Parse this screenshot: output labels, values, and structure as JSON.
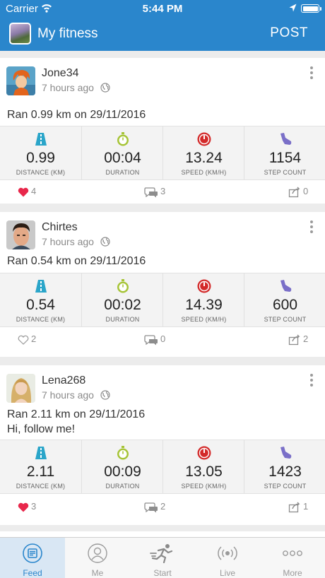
{
  "status_bar": {
    "carrier": "Carrier",
    "time": "5:44 PM"
  },
  "app_bar": {
    "title": "My fitness",
    "post_label": "POST"
  },
  "colors": {
    "primary": "#2a86cc",
    "distance": "#2aa5c9",
    "duration": "#a6c437",
    "speed": "#d32a2a",
    "steps": "#7a6fc8",
    "like_active": "#e8274b"
  },
  "stat_labels": {
    "distance": "DISTANCE (KM)",
    "duration": "DURATION",
    "speed": "SPEED (KM/H)",
    "steps": "STEP COUNT"
  },
  "posts": [
    {
      "username": "Jone34",
      "time_ago": "7 hours ago",
      "desc1": "Ran 0.99 km on 29/11/2016",
      "desc2": "",
      "distance": "0.99",
      "duration": "00:04",
      "speed": "13.24",
      "steps": "1154",
      "likes": "4",
      "liked": true,
      "comments": "3",
      "shares": "0"
    },
    {
      "username": "Chirtes",
      "time_ago": "7 hours ago",
      "desc1": "Ran 0.54 km on 29/11/2016",
      "desc2": "",
      "distance": "0.54",
      "duration": "00:02",
      "speed": "14.39",
      "steps": "600",
      "likes": "2",
      "liked": false,
      "comments": "0",
      "shares": "2"
    },
    {
      "username": "Lena268",
      "time_ago": "7 hours ago",
      "desc1": "Ran 2.11 km on 29/11/2016",
      "desc2": "Hi, follow me!",
      "distance": "2.11",
      "duration": "00:09",
      "speed": "13.05",
      "steps": "1423",
      "likes": "3",
      "liked": true,
      "comments": "2",
      "shares": "1"
    }
  ],
  "tabs": [
    {
      "label": "Feed",
      "icon": "feed-icon",
      "active": true
    },
    {
      "label": "Me",
      "icon": "profile-icon",
      "active": false
    },
    {
      "label": "Start",
      "icon": "runner-icon",
      "active": false
    },
    {
      "label": "Live",
      "icon": "live-icon",
      "active": false
    },
    {
      "label": "More",
      "icon": "more-icon",
      "active": false
    }
  ]
}
